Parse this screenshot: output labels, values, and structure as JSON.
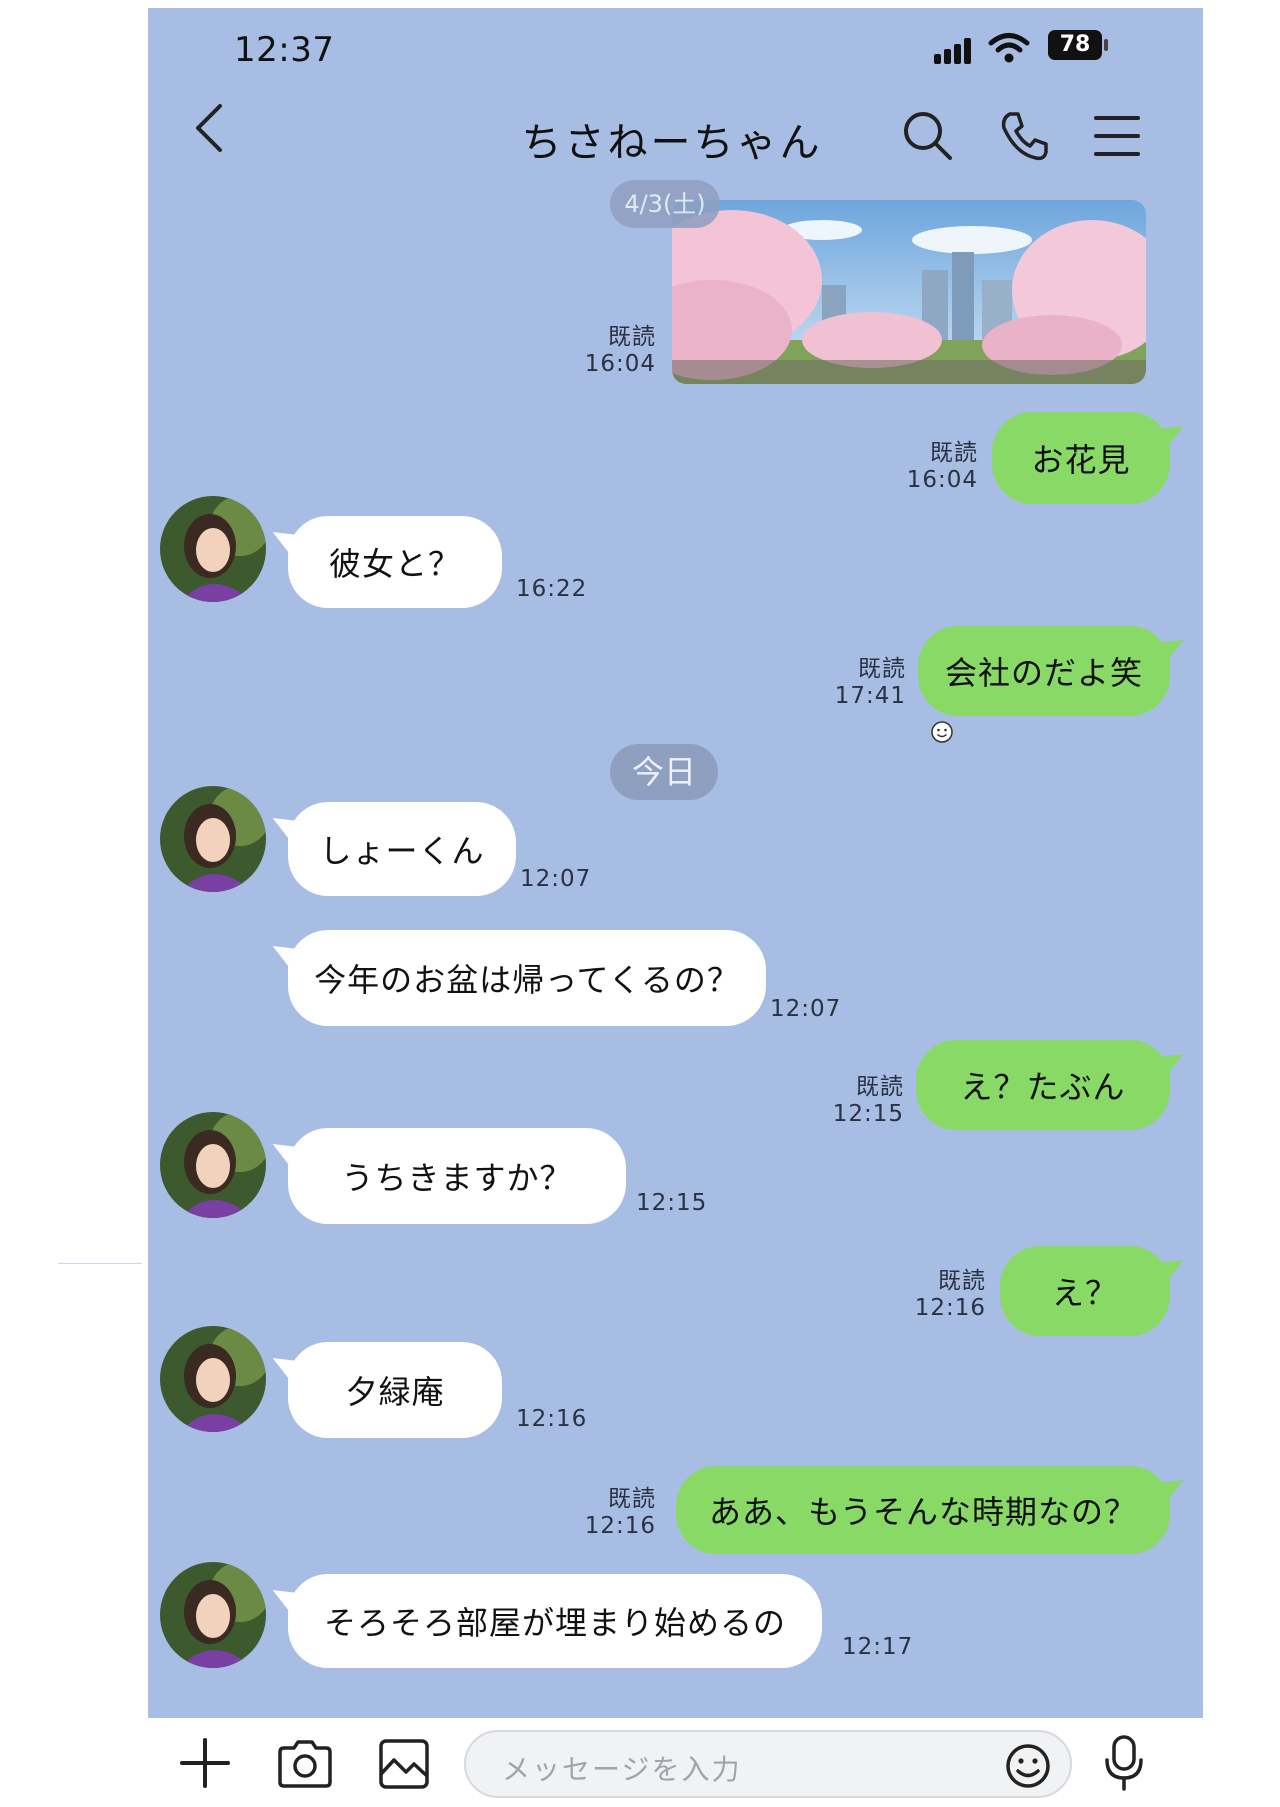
{
  "status_bar": {
    "time": "12:37",
    "battery": "78"
  },
  "header": {
    "title": "ちさねーちゃん"
  },
  "chat": {
    "date_chip_1": "4/3(土)",
    "date_chip_2": "今日",
    "read_label": "既読",
    "messages": [
      {
        "side": "me",
        "type": "image",
        "read": "既読",
        "time": "16:04"
      },
      {
        "side": "me",
        "text": "お花見",
        "read": "既読",
        "time": "16:04"
      },
      {
        "side": "them",
        "text": "彼女と？",
        "time": "16:22"
      },
      {
        "side": "me",
        "text": "会社のだよ笑",
        "read": "既読",
        "time": "17:41"
      },
      {
        "side": "them",
        "text": "しょーくん",
        "time": "12:07"
      },
      {
        "side": "them",
        "text": "今年のお盆は帰ってくるの？",
        "time": "12:07"
      },
      {
        "side": "me",
        "text": "え？たぶん",
        "read": "既読",
        "time": "12:15"
      },
      {
        "side": "them",
        "text": "うちきますか？",
        "time": "12:15"
      },
      {
        "side": "me",
        "text": "え？",
        "read": "既読",
        "time": "12:16"
      },
      {
        "side": "them",
        "text": "夕緑庵",
        "time": "12:16"
      },
      {
        "side": "me",
        "text": "ああ、もうそんな時期なの？",
        "read": "既読",
        "time": "12:16"
      },
      {
        "side": "them",
        "text": "そろそろ部屋が埋まり始めるの",
        "time": "12:17"
      }
    ]
  },
  "composer": {
    "placeholder": "メッセージを入力"
  },
  "colors": {
    "background": "#a7bde3",
    "my_bubble": "#88d966",
    "their_bubble": "#ffffff",
    "date_chip": "#8f9fc0"
  },
  "icons": [
    "back-icon",
    "search-icon",
    "phone-icon",
    "menu-icon",
    "plus-icon",
    "camera-icon",
    "image-icon",
    "emoji-icon",
    "mic-icon"
  ]
}
